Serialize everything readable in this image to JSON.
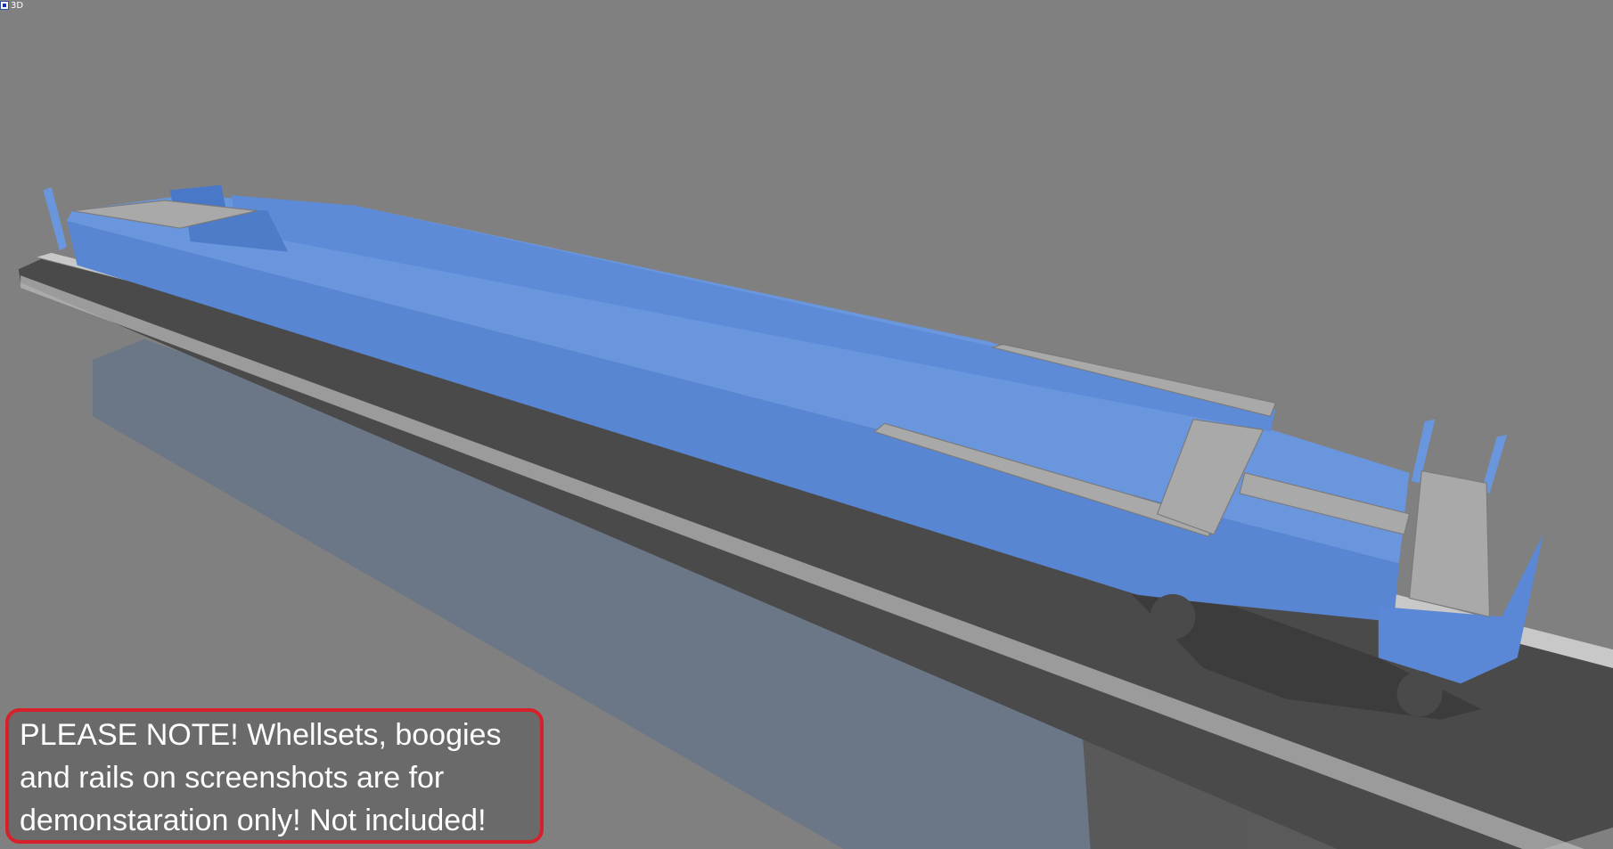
{
  "viewport": {
    "label": "3D"
  },
  "note": {
    "lines": [
      "PLEASE NOTE! Whellsets, boogies",
      "and rails on screenshots are for",
      "demonstaration only! Not included!"
    ],
    "border_color": "#d8202a"
  },
  "colors": {
    "background": "#808080",
    "wagon": "#5f8fdc",
    "grating": "#a8a8a8"
  }
}
